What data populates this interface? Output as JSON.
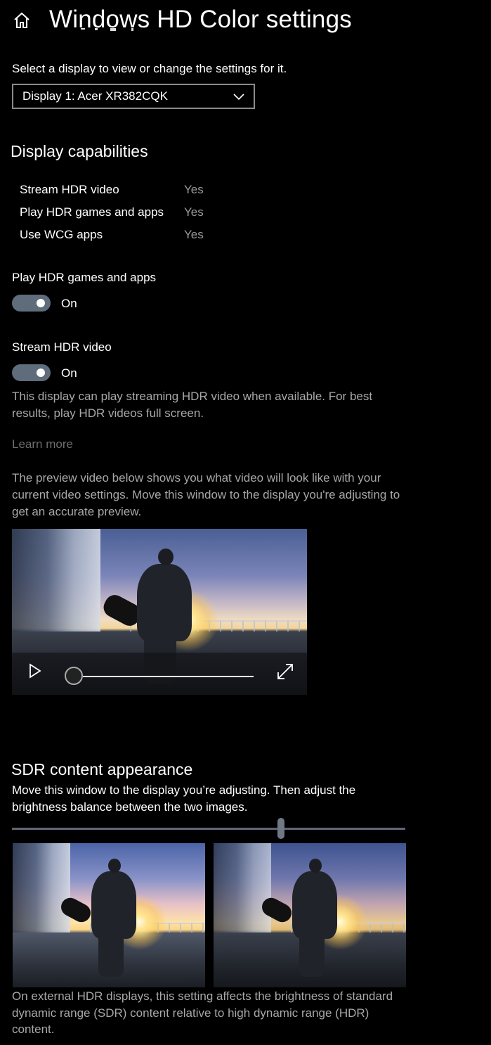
{
  "header": {
    "title": "Windows HD Color settings",
    "home_icon": "home-icon"
  },
  "display_select": {
    "prompt": "Select a display to view or change the settings for it.",
    "selected": "Display 1: Acer XR382CQK",
    "dropdown_icon": "chevron-down-icon"
  },
  "capabilities": {
    "heading": "Display capabilities",
    "rows": [
      {
        "label": "Stream HDR video",
        "value": "Yes"
      },
      {
        "label": "Play HDR games and apps",
        "value": "Yes"
      },
      {
        "label": "Use WCG apps",
        "value": "Yes"
      }
    ]
  },
  "hdr_games": {
    "label": "Play HDR games and apps",
    "state": "On"
  },
  "hdr_video": {
    "label": "Stream HDR video",
    "state": "On",
    "description": "This display can play streaming HDR video when available. For best results, play HDR videos full screen.",
    "learn_more": "Learn more"
  },
  "preview": {
    "description": "The preview video below shows you what video will look like with your current video settings. Move this window to the display you're adjusting to get an accurate preview.",
    "play_icon": "play-icon",
    "fullscreen_icon": "fullscreen-icon",
    "progress": 0
  },
  "sdr": {
    "heading": "SDR content appearance",
    "instruction": "Move this window to the display you’re adjusting. Then adjust the brightness balance between the two images.",
    "slider_level": 0.68,
    "footer": "On external HDR displays, this setting affects the brightness of standard dynamic range (SDR) content relative to high dynamic range (HDR) content."
  },
  "colors": {
    "toggle_on": "#5f6c7b",
    "secondary_text": "#a8a8a8",
    "link": "#6d6d6d",
    "background": "#000000"
  }
}
